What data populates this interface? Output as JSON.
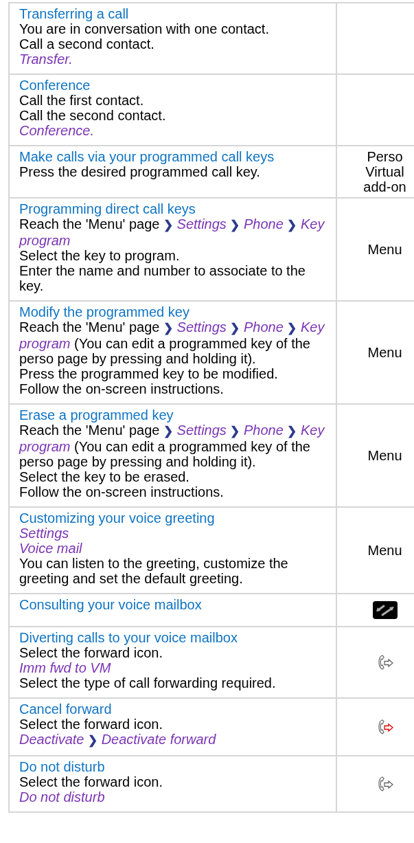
{
  "rows": [
    {
      "title": "Transferring a call",
      "lines": [
        {
          "kind": "text",
          "text": "You are in conversation with one contact."
        },
        {
          "kind": "text",
          "text": "Call a second contact."
        },
        {
          "kind": "option",
          "text": "Transfer."
        }
      ]
    },
    {
      "title": "Conference",
      "lines": [
        {
          "kind": "text",
          "text": "Call the first contact."
        },
        {
          "kind": "text",
          "text": "Call the second contact."
        },
        {
          "kind": "option",
          "text": "Conference."
        }
      ]
    },
    {
      "title": "Make calls via your programmed call keys",
      "lines": [
        {
          "kind": "text",
          "text": "Press the desired programmed call key."
        }
      ],
      "side": {
        "kind": "text",
        "text": "Perso Virtual add-on"
      }
    },
    {
      "title": "Programming direct call keys",
      "lines": [
        {
          "kind": "text",
          "text": "Reach the 'Menu' page ❯ *Settings* ❯ *Phone* ❯ *Key program*"
        },
        {
          "kind": "text",
          "text": "Select the key to program."
        },
        {
          "kind": "text",
          "text": "Enter the name and number to associate to the key."
        }
      ],
      "side": {
        "kind": "text",
        "text": "Menu"
      }
    },
    {
      "title": "Modify the programmed key",
      "lines": [
        {
          "kind": "text",
          "text": "Reach the 'Menu' page ❯ *Settings* ❯ *Phone* ❯ *Key program* (You can edit a programmed key of the perso page by pressing and holding it)."
        },
        {
          "kind": "text",
          "text": "Press the programmed key to be modified."
        },
        {
          "kind": "text",
          "text": "Follow the on-screen instructions."
        }
      ],
      "side": {
        "kind": "text",
        "text": "Menu"
      }
    },
    {
      "title": "Erase a programmed key",
      "lines": [
        {
          "kind": "text",
          "text": "Reach the 'Menu' page ❯ *Settings* ❯ *Phone* ❯ *Key program* (You can edit a programmed key of the perso page by pressing and holding it)."
        },
        {
          "kind": "text",
          "text": "Select the key to be erased."
        },
        {
          "kind": "text",
          "text": "Follow the on-screen instructions."
        }
      ],
      "side": {
        "kind": "text",
        "text": "Menu"
      }
    },
    {
      "title": "Customizing your voice greeting",
      "lines": [
        {
          "kind": "option",
          "text": "Settings"
        },
        {
          "kind": "option",
          "text": "Voice mail"
        },
        {
          "kind": "text",
          "text": "You can listen to the greeting, customize the greeting and set the default greeting."
        }
      ],
      "side": {
        "kind": "text",
        "text": "Menu"
      }
    },
    {
      "title": "Consulting your voice mailbox",
      "side": {
        "kind": "mailbox-key"
      }
    },
    {
      "title": "Diverting calls to your voice mailbox",
      "lines": [
        {
          "kind": "text",
          "text": "Select the forward icon."
        },
        {
          "kind": "option",
          "text": "Imm fwd to VM"
        },
        {
          "kind": "text",
          "text": "Select the type of call forwarding required."
        }
      ],
      "side": {
        "kind": "forward"
      }
    },
    {
      "title": "Cancel forward",
      "lines": [
        {
          "kind": "text",
          "text": "Select the forward icon."
        },
        {
          "kind": "text",
          "text": "*Deactivate* ❯ *Deactivate forward*"
        }
      ],
      "side": {
        "kind": "forward-cancel"
      }
    },
    {
      "title": "Do not disturb",
      "lines": [
        {
          "kind": "text",
          "text": "Select the forward icon."
        },
        {
          "kind": "option",
          "text": "Do not disturb"
        }
      ],
      "side": {
        "kind": "forward"
      }
    }
  ]
}
